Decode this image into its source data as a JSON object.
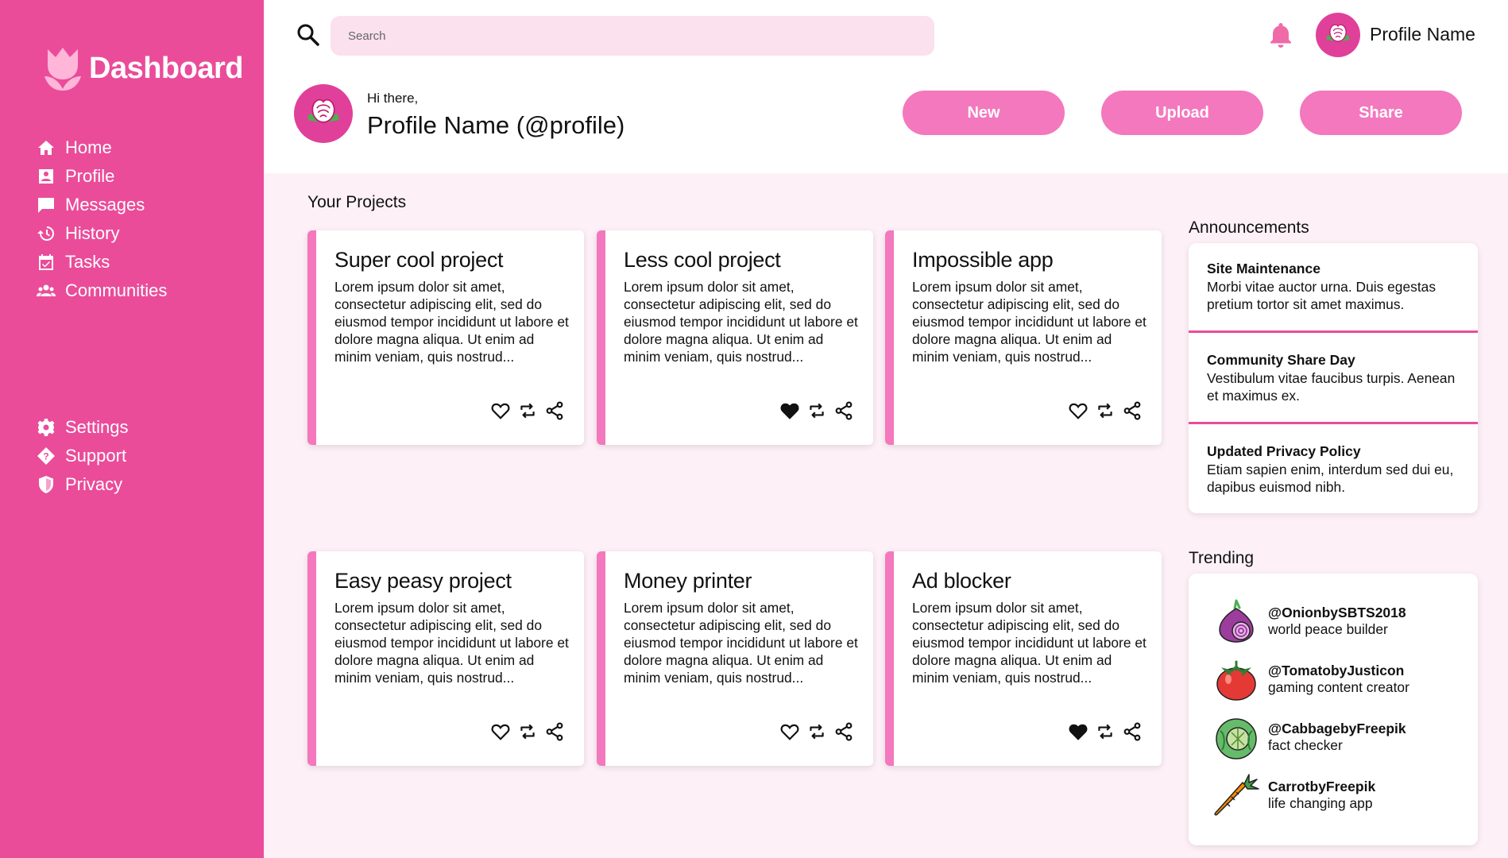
{
  "sidebar": {
    "brand": "Dashboard",
    "nav_top": [
      {
        "label": "Home",
        "icon": "home-icon"
      },
      {
        "label": "Profile",
        "icon": "profile-icon"
      },
      {
        "label": "Messages",
        "icon": "messages-icon"
      },
      {
        "label": "History",
        "icon": "history-icon"
      },
      {
        "label": "Tasks",
        "icon": "tasks-icon"
      },
      {
        "label": "Communities",
        "icon": "communities-icon"
      }
    ],
    "nav_bottom": [
      {
        "label": "Settings",
        "icon": "gear-icon"
      },
      {
        "label": "Support",
        "icon": "support-icon"
      },
      {
        "label": "Privacy",
        "icon": "shield-icon"
      }
    ]
  },
  "header": {
    "search_placeholder": "Search",
    "profile_name": "Profile Name",
    "greeting": "Hi there,",
    "greeting_name": "Profile Name (@profile)",
    "actions": [
      "New",
      "Upload",
      "Share"
    ]
  },
  "projects": {
    "title": "Your Projects",
    "items": [
      {
        "title": "Super cool project",
        "desc": "Lorem ipsum dolor sit amet, consectetur adipiscing elit, sed do eiusmod tempor incididunt ut labore et dolore magna aliqua. Ut enim ad minim veniam, quis nostrud...",
        "liked": false
      },
      {
        "title": "Less cool project",
        "desc": "Lorem ipsum dolor sit amet, consectetur adipiscing elit, sed do eiusmod tempor incididunt ut labore et dolore magna aliqua. Ut enim ad minim veniam, quis nostrud...",
        "liked": true
      },
      {
        "title": "Impossible app",
        "desc": "Lorem ipsum dolor sit amet, consectetur adipiscing elit, sed do eiusmod tempor incididunt ut labore et dolore magna aliqua. Ut enim ad minim veniam, quis nostrud...",
        "liked": false
      },
      {
        "title": "Easy peasy project",
        "desc": "Lorem ipsum dolor sit amet, consectetur adipiscing elit, sed do eiusmod tempor incididunt ut labore et dolore magna aliqua. Ut enim ad minim veniam, quis nostrud...",
        "liked": false
      },
      {
        "title": "Money printer",
        "desc": "Lorem ipsum dolor sit amet, consectetur adipiscing elit, sed do eiusmod tempor incididunt ut labore et dolore magna aliqua. Ut enim ad minim veniam, quis nostrud...",
        "liked": false
      },
      {
        "title": "Ad blocker",
        "desc": "Lorem ipsum dolor sit amet, consectetur adipiscing elit, sed do eiusmod tempor incididunt ut labore et dolore magna aliqua. Ut enim ad minim veniam, quis nostrud...",
        "liked": true
      }
    ]
  },
  "announcements": {
    "title": "Announcements",
    "items": [
      {
        "title": "Site Maintenance",
        "body": "Morbi vitae auctor urna. Duis egestas pretium tortor sit amet maximus."
      },
      {
        "title": "Community Share Day",
        "body": "Vestibulum vitae faucibus turpis. Aenean et maximus ex."
      },
      {
        "title": "Updated Privacy Policy",
        "body": "Etiam sapien enim, interdum sed dui eu, dapibus euismod nibh."
      }
    ]
  },
  "trending": {
    "title": "Trending",
    "items": [
      {
        "handle": "@OnionbySBTS2018",
        "desc": "world peace builder",
        "icon": "onion-icon"
      },
      {
        "handle": "@TomatobyJusticon",
        "desc": "gaming content creator",
        "icon": "tomato-icon"
      },
      {
        "handle": "@CabbagebyFreepik",
        "desc": "fact checker",
        "icon": "cabbage-icon"
      },
      {
        "handle": "CarrotbyFreepik",
        "desc": "life changing app",
        "icon": "carrot-icon"
      }
    ]
  },
  "colors": {
    "sidebar": "#ea4c9a",
    "accent": "#f478bd",
    "search_bg": "#fbe0ee",
    "content_bg": "#fdf0f6",
    "bell": "#f06aa8"
  }
}
